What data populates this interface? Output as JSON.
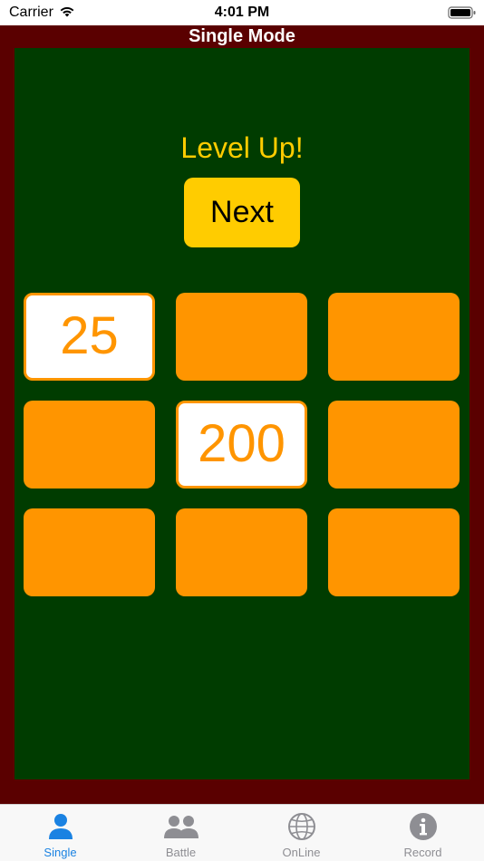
{
  "status_bar": {
    "carrier": "Carrier",
    "time": "4:01 PM",
    "icons": [
      "wifi-icon",
      "battery-icon"
    ]
  },
  "header": {
    "title": "Single Mode"
  },
  "game": {
    "message": "Level Up!",
    "next_label": "Next",
    "tiles": [
      {
        "value": "25",
        "revealed": true
      },
      {
        "value": "",
        "revealed": false
      },
      {
        "value": "",
        "revealed": false
      },
      {
        "value": "",
        "revealed": false
      },
      {
        "value": "200",
        "revealed": true
      },
      {
        "value": "",
        "revealed": false
      },
      {
        "value": "",
        "revealed": false
      },
      {
        "value": "",
        "revealed": false
      },
      {
        "value": "",
        "revealed": false
      }
    ]
  },
  "tab_bar": {
    "active": "Single",
    "tabs": [
      {
        "label": "Single",
        "icon": "person-icon"
      },
      {
        "label": "Battle",
        "icon": "people-icon"
      },
      {
        "label": "OnLine",
        "icon": "globe-icon"
      },
      {
        "label": "Record",
        "icon": "info-icon"
      }
    ]
  },
  "colors": {
    "frame": "#5a0000",
    "board": "#003c00",
    "accent_yellow": "#ffcc00",
    "tile_orange": "#ff9500",
    "tab_active": "#1a82e2",
    "tab_inactive": "#8e8e93"
  }
}
